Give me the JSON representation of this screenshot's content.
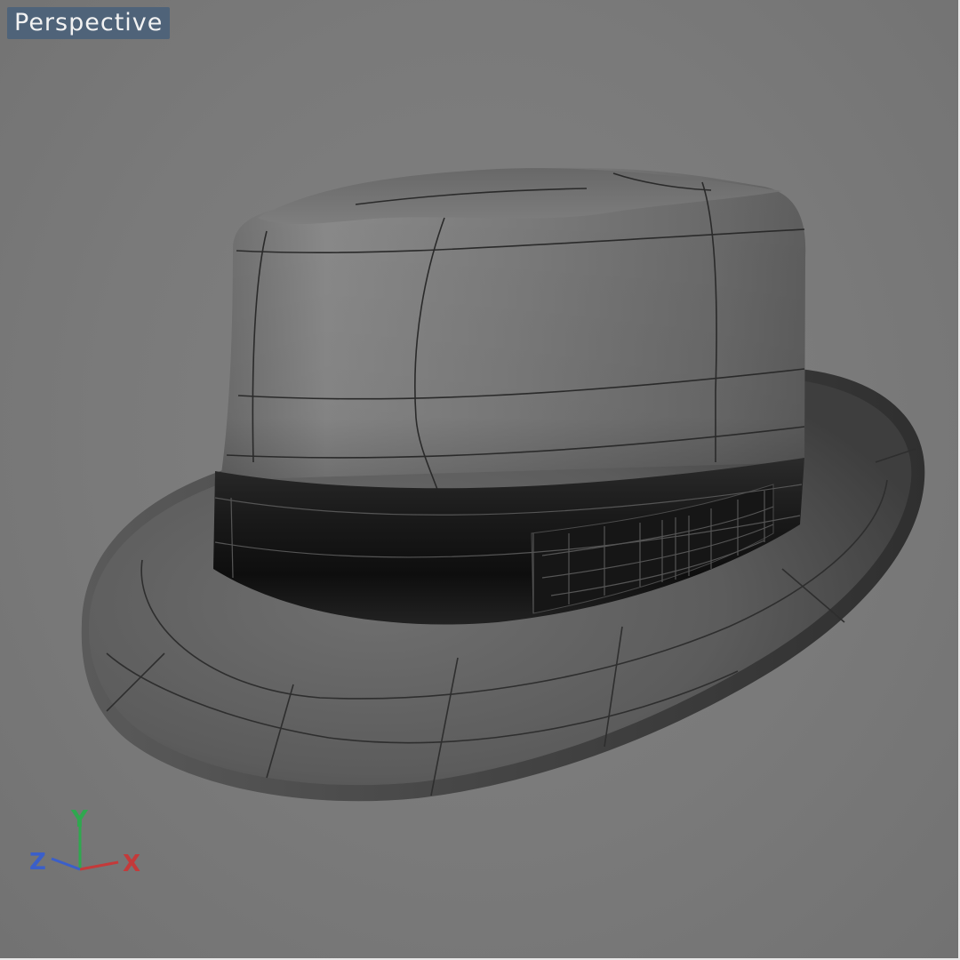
{
  "viewport": {
    "label": "Perspective",
    "background": "#7a7a7a",
    "label_background": "#4f6379"
  },
  "model": {
    "icon": "fedora-hat-model",
    "display_mode": "smooth-shaded-wireframe-on-shaded"
  },
  "axis_gizmo": {
    "x_label": "X",
    "y_label": "Y",
    "z_label": "Z",
    "x_color": "#c43a3a",
    "y_color": "#2fa84f",
    "z_color": "#3b5fc9"
  }
}
